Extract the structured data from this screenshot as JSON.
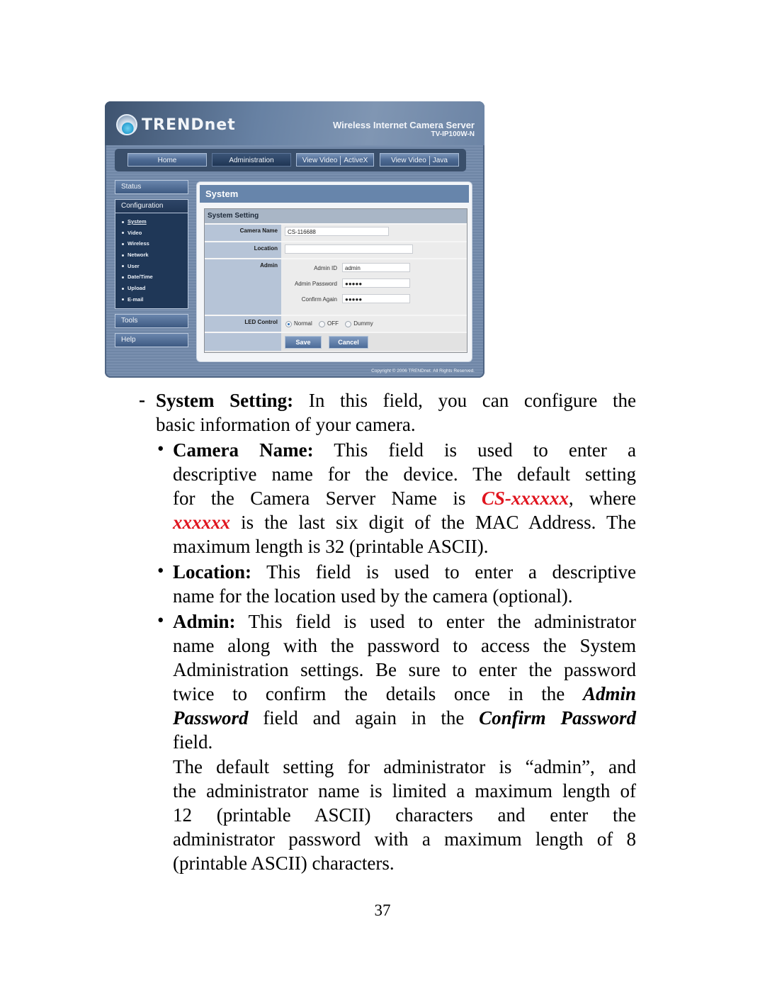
{
  "screenshot": {
    "brand": "TRENDnet",
    "product_title": "Wireless Internet Camera Server",
    "product_model": "TV-IP100W-N",
    "nav": [
      {
        "label": "Home",
        "active": false
      },
      {
        "label": "Administration",
        "active": true
      },
      {
        "label_a": "View Video",
        "label_b": "ActiveX",
        "active": false
      },
      {
        "label_a": "View Video",
        "label_b": "Java",
        "active": false
      }
    ],
    "sidebar": {
      "status": "Status",
      "configuration": "Configuration",
      "config_items": [
        "System",
        "Video",
        "Wireless",
        "Network",
        "User",
        "Date/Time",
        "Upload",
        "E-mail"
      ],
      "current_item": "System",
      "tools": "Tools",
      "help": "Help"
    },
    "panel": {
      "title": "System",
      "section_title": "System Setting",
      "camera_name_label": "Camera Name",
      "camera_name_value": "CS-116688",
      "location_label": "Location",
      "location_value": "",
      "admin_label": "Admin",
      "admin_id_label": "Admin ID",
      "admin_id_value": "admin",
      "admin_password_label": "Admin Password",
      "admin_password_value": "●●●●●",
      "confirm_label": "Confirm Again",
      "confirm_value": "●●●●●",
      "led_label": "LED Control",
      "led_options": [
        "Normal",
        "OFF",
        "Dummy"
      ],
      "led_selected": "Normal",
      "save_label": "Save",
      "cancel_label": "Cancel"
    },
    "copyright": "Copyright © 2006 TRENDnet. All Rights Reserved."
  },
  "document": {
    "dash": "-",
    "system_setting": {
      "term": "System Setting:",
      "line1_rest": " In this field, you can configure the",
      "line2": "basic information of your camera."
    },
    "bullets": {
      "symbol": "•",
      "camera_name": {
        "term": "Camera Name:",
        "line1_rest": " This field is used to enter a",
        "line2": "descriptive name for the device.  The default setting",
        "line3_pre": "for the Camera Server Name is ",
        "line3_red": "CS-xxxxxx",
        "line3_post": ", where",
        "line4_red": "xxxxxx",
        "line4_post": " is the last six digit of the MAC Address.  The",
        "line5": "maximum length is 32 (printable ASCII)."
      },
      "location": {
        "term": "Location:",
        "line1_rest": " This field is used to enter a descriptive",
        "line2": "name for the location used by the camera (optional)."
      },
      "admin": {
        "term": "Admin:",
        "line1_rest": " This field is used to enter the administrator",
        "line2": "name along with the password to access the System",
        "line3": "Administration settings.  Be sure to enter the password",
        "line4_pre": "twice to confirm the details once in the ",
        "line4_bi": "Admin",
        "line5_bi": "Password",
        "line5_mid": " field and again in the ",
        "line5_bi2": "Confirm Password",
        "line6": "field."
      },
      "admin_note": [
        "The default setting for administrator is “admin”, and",
        "the administrator name is limited a maximum length of",
        "12 (printable ASCII) characters and enter the",
        "administrator password with a maximum length of 8",
        "(printable ASCII) characters."
      ]
    },
    "page_number": "37"
  }
}
